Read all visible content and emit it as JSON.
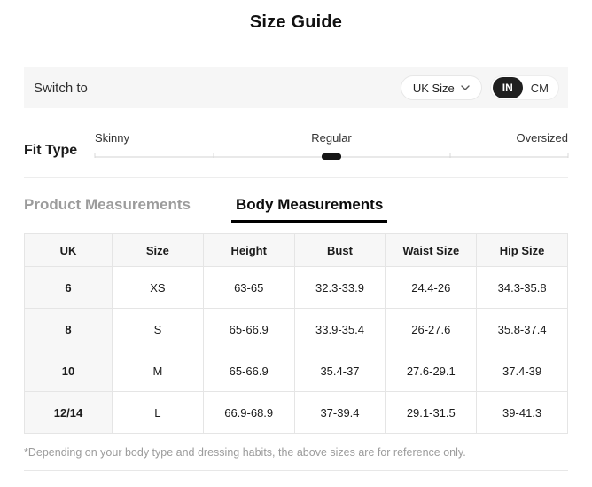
{
  "title": "Size Guide",
  "switch_bar": {
    "label": "Switch to",
    "size_dropdown": {
      "value": "UK Size"
    },
    "unit_toggle": {
      "options": [
        "IN",
        "CM"
      ],
      "selected": "IN"
    }
  },
  "fit_type": {
    "label": "Fit Type",
    "options": [
      "Skinny",
      "Regular",
      "Oversized"
    ],
    "selected": "Regular"
  },
  "tabs": [
    {
      "label": "Product Measurements",
      "active": false
    },
    {
      "label": "Body Measurements",
      "active": true
    }
  ],
  "table": {
    "headers": [
      "UK",
      "Size",
      "Height",
      "Bust",
      "Waist Size",
      "Hip Size"
    ],
    "rows": [
      [
        "6",
        "XS",
        "63-65",
        "32.3-33.9",
        "24.4-26",
        "34.3-35.8"
      ],
      [
        "8",
        "S",
        "65-66.9",
        "33.9-35.4",
        "26-27.6",
        "35.8-37.4"
      ],
      [
        "10",
        "M",
        "65-66.9",
        "35.4-37",
        "27.6-29.1",
        "37.4-39"
      ],
      [
        "12/14",
        "L",
        "66.9-68.9",
        "37-39.4",
        "29.1-31.5",
        "39-41.3"
      ]
    ]
  },
  "footnote": "*Depending on your body type and dressing habits, the above sizes are for reference only.",
  "colors": {
    "accent_dark": "#1f1f1f",
    "bar_background": "#f6f6f6",
    "table_border": "#e5e5e5",
    "muted_text": "#9b9b9b"
  }
}
